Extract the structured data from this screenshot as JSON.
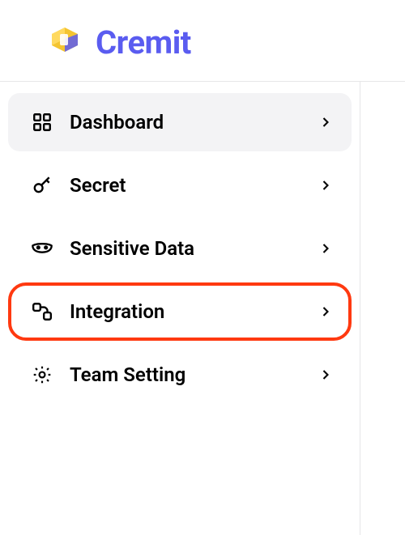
{
  "brand": {
    "name": "Cremit"
  },
  "nav": {
    "items": [
      {
        "label": "Dashboard",
        "icon": "dashboard-icon",
        "selected": true,
        "highlighted": false
      },
      {
        "label": "Secret",
        "icon": "key-icon",
        "selected": false,
        "highlighted": false
      },
      {
        "label": "Sensitive Data",
        "icon": "mask-icon",
        "selected": false,
        "highlighted": false
      },
      {
        "label": "Integration",
        "icon": "integration-icon",
        "selected": false,
        "highlighted": true
      },
      {
        "label": "Team Setting",
        "icon": "settings-icon",
        "selected": false,
        "highlighted": false
      }
    ]
  }
}
